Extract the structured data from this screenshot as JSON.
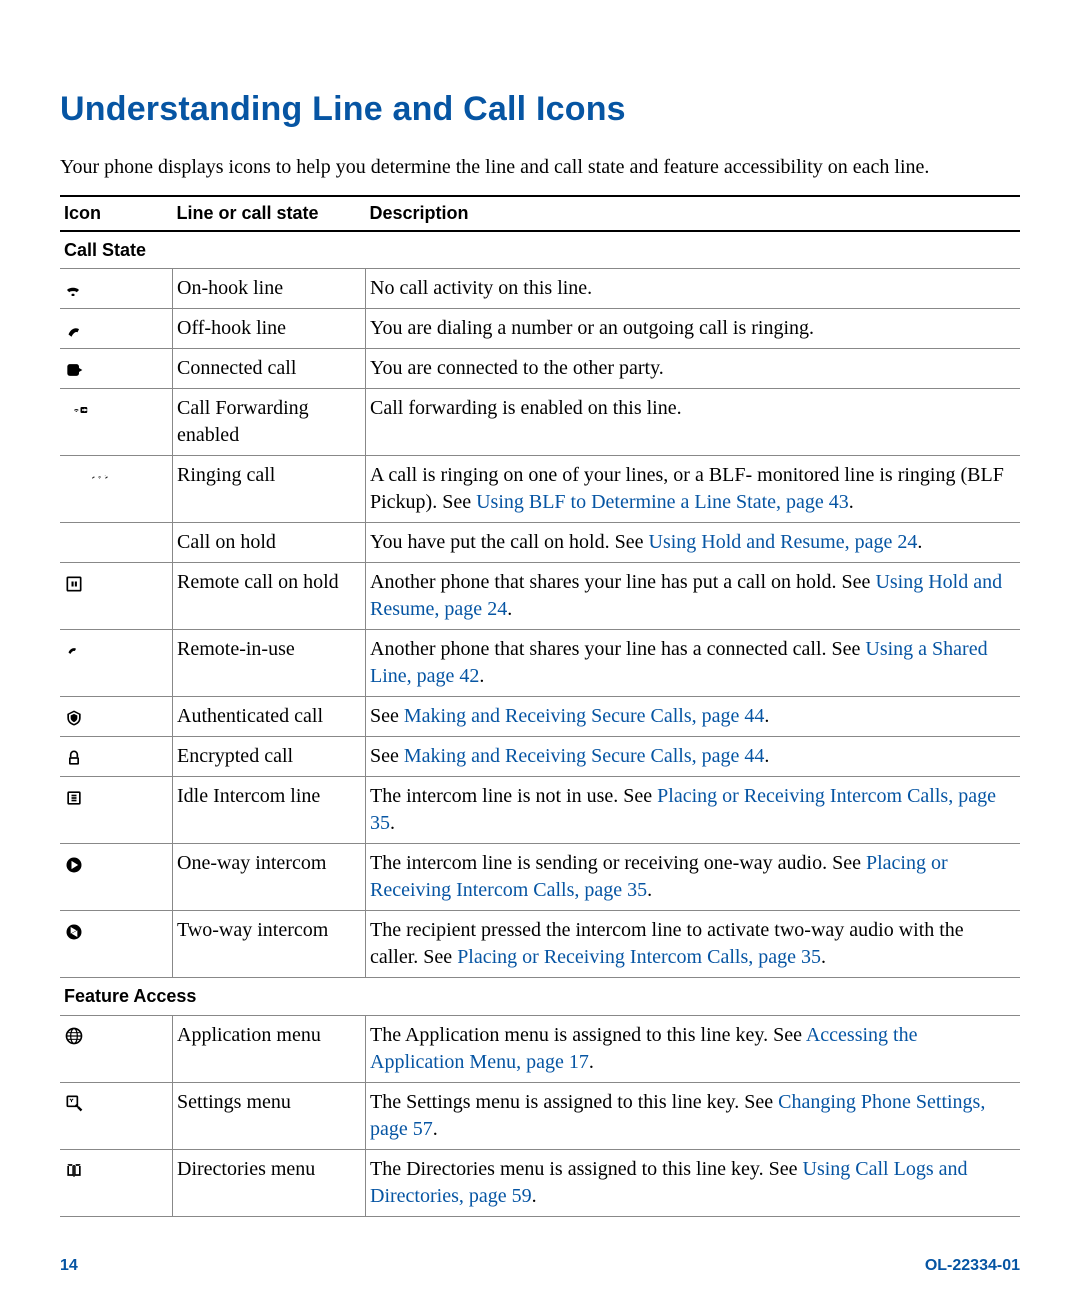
{
  "heading": "Understanding Line and Call Icons",
  "intro": "Your phone displays icons to help you determine the line and call state and feature accessibility on each line.",
  "table": {
    "head": {
      "c1": "Icon",
      "c2": "Line or call state",
      "c3": "Description"
    },
    "section1": "Call State",
    "section2": "Feature Access",
    "rows": [
      {
        "icon": "on-hook-icon",
        "state": "On-hook line",
        "desc_pre": "No call activity on this line.",
        "link": "",
        "desc_post": ""
      },
      {
        "icon": "off-hook-icon",
        "state": "Off-hook line",
        "desc_pre": "You are dialing a number or an outgoing call is ringing.",
        "link": "",
        "desc_post": ""
      },
      {
        "icon": "connected-call-icon",
        "state": "Connected call",
        "desc_pre": "You are connected to the other party.",
        "link": "",
        "desc_post": ""
      },
      {
        "icon": "call-forward-icon",
        "state": "Call Forwarding enabled",
        "desc_pre": "Call forwarding is enabled on this line.",
        "link": "",
        "desc_post": ""
      },
      {
        "icon": "ringing-call-icon",
        "state": "Ringing call",
        "desc_pre": "A call is ringing on one of your lines, or a BLF- monitored line is ringing (BLF Pickup). See ",
        "link": "Using BLF to Determine a Line State, page 43",
        "desc_post": "."
      },
      {
        "icon": "",
        "state": "Call on hold",
        "desc_pre": "You have put the call on hold. See ",
        "link": "Using Hold and Resume, page 24",
        "desc_post": "."
      },
      {
        "icon": "remote-hold-icon",
        "state": "Remote call on hold",
        "desc_pre": "Another phone that shares your line has put a call on hold. See ",
        "link": "Using Hold and Resume, page 24",
        "desc_post": "."
      },
      {
        "icon": "remote-in-use-icon",
        "state": "Remote-in-use",
        "desc_pre": "Another phone that shares your line has a connected call. See ",
        "link": "Using a Shared Line, page 42",
        "desc_post": "."
      },
      {
        "icon": "authenticated-call-icon",
        "state": "Authenticated call",
        "desc_pre": "See ",
        "link": "Making and Receiving Secure Calls, page 44",
        "desc_post": "."
      },
      {
        "icon": "encrypted-call-icon",
        "state": "Encrypted call",
        "desc_pre": "See ",
        "link": "Making and Receiving Secure Calls, page 44",
        "desc_post": "."
      },
      {
        "icon": "idle-intercom-icon",
        "state": "Idle Intercom line",
        "desc_pre": "The intercom line is not in use. See ",
        "link": "Placing or Receiving Intercom Calls, page 35",
        "desc_post": "."
      },
      {
        "icon": "one-way-intercom-icon",
        "state": "One-way intercom",
        "desc_pre": "The intercom line is sending or receiving one-way audio. See ",
        "link": "Placing or Receiving Intercom Calls, page 35",
        "desc_post": "."
      },
      {
        "icon": "two-way-intercom-icon",
        "state": "Two-way intercom",
        "desc_pre": "The recipient pressed the intercom line to activate two-way audio with the caller. See ",
        "link": "Placing or Receiving Intercom Calls, page 35",
        "desc_post": "."
      }
    ],
    "rows2": [
      {
        "icon": "application-menu-icon",
        "state": "Application menu",
        "desc_pre": "The Application menu is assigned to this line key. See ",
        "link": "Accessing the Application Menu, page 17",
        "desc_post": "."
      },
      {
        "icon": "settings-menu-icon",
        "state": "Settings menu",
        "desc_pre": "The Settings menu is assigned to this line key. See ",
        "link": "Changing Phone Settings, page 57",
        "desc_post": "."
      },
      {
        "icon": "directories-menu-icon",
        "state": "Directories menu",
        "desc_pre": "The Directories menu is assigned to this line key. See ",
        "link": "Using Call Logs and Directories, page 59",
        "desc_post": "."
      }
    ]
  },
  "footer": {
    "page": "14",
    "doc": "OL-22334-01"
  }
}
